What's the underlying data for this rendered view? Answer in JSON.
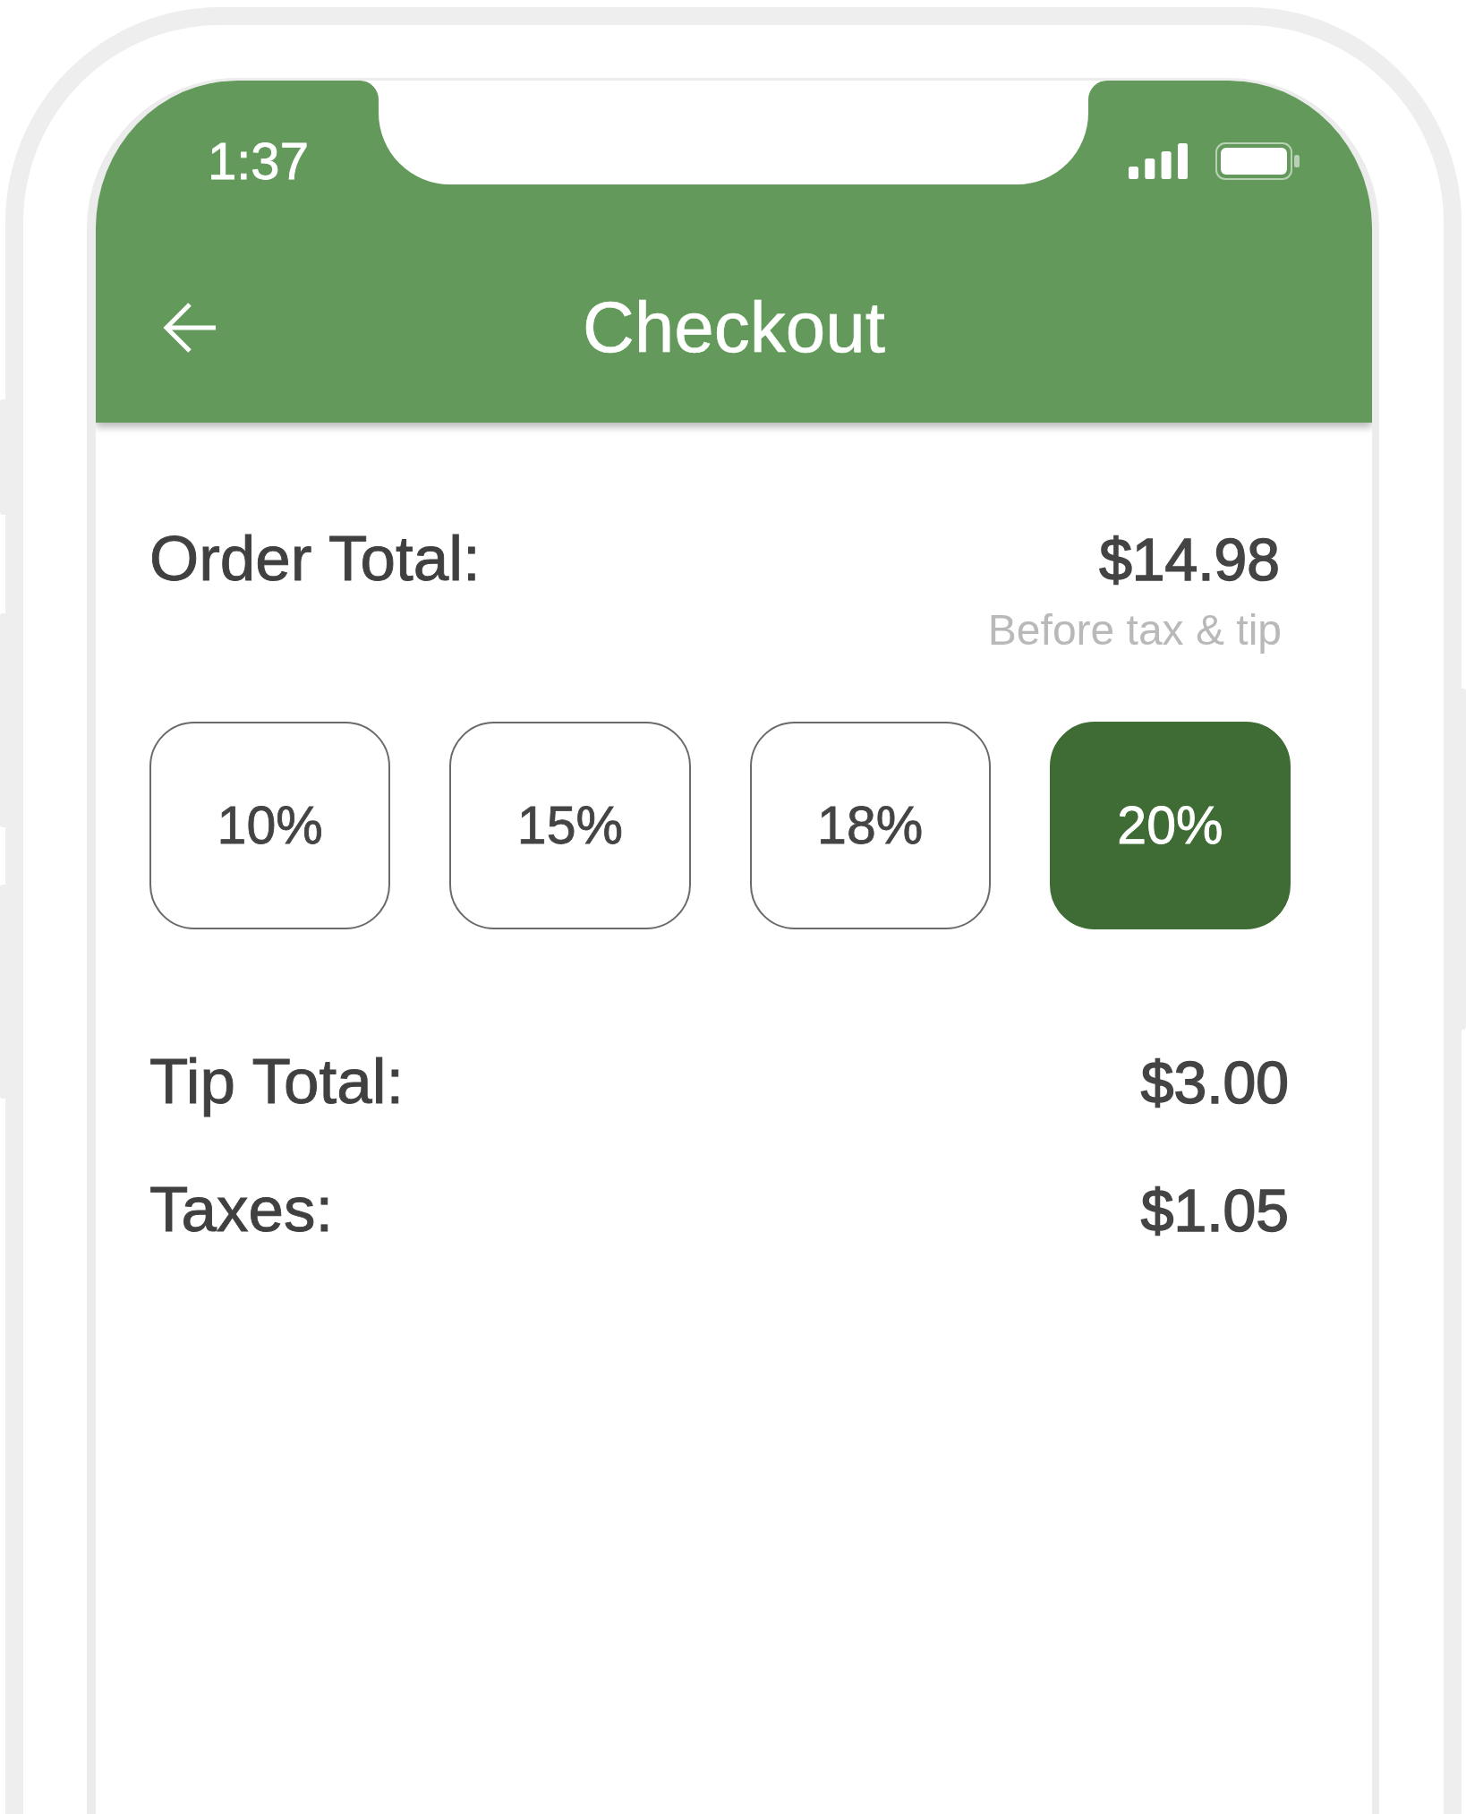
{
  "status_bar": {
    "time": "1:37"
  },
  "app_bar": {
    "title": "Checkout"
  },
  "order_total": {
    "label": "Order Total:",
    "value": "$14.98",
    "note": "Before tax & tip"
  },
  "tip_options": [
    {
      "label": "10%",
      "selected": false
    },
    {
      "label": "15%",
      "selected": false
    },
    {
      "label": "18%",
      "selected": false
    },
    {
      "label": "20%",
      "selected": true
    }
  ],
  "summary": [
    {
      "label": "Tip Total:",
      "value": "$3.00"
    },
    {
      "label": "Taxes:",
      "value": "$1.05"
    }
  ]
}
